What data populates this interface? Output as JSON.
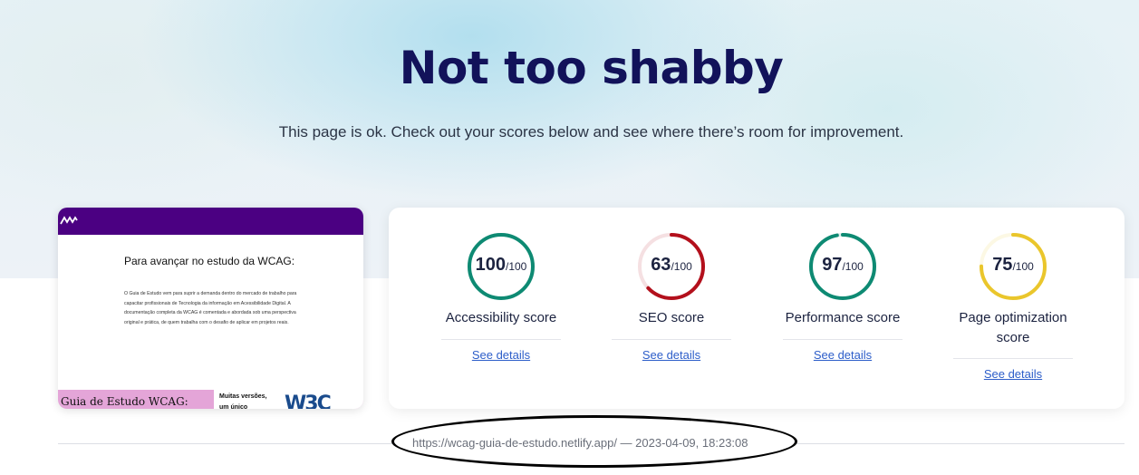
{
  "hero": {
    "title": "Not too shabby",
    "subtitle": "This page is ok. Check out your scores below and see where there’s room for improvement."
  },
  "thumbnail": {
    "heading": "Para avançar no estudo da WCAG:",
    "body": "O Guia de Estudo vem para suprir a demanda dentro do mercado de trabalho para capacitar profissionais de Tecnologia da informação em Acessibilidade Digital. A documentação completa da WCAG é comentada e abordada sob uma perspectiva original e prática, de quem trabalha com o desafio de aplicar em projetos reais.",
    "band_text": "Guia de Estudo WCAG:",
    "side_text": "Muitas versões, um único",
    "logo_text": "W3C",
    "colors": {
      "bar": "#4b0082",
      "band": "#e4a5d8"
    }
  },
  "scores": [
    {
      "value": 100,
      "max": "/100",
      "label": "Accessibility score",
      "link": "See details",
      "color": "#0e8a73"
    },
    {
      "value": 63,
      "max": "/100",
      "label": "SEO score",
      "link": "See details",
      "color": "#b3101c"
    },
    {
      "value": 97,
      "max": "/100",
      "label": "Performance score",
      "link": "See details",
      "color": "#0e8a73"
    },
    {
      "value": 75,
      "max": "/100",
      "label": "Page optimization score",
      "link": "See details",
      "color": "#eac62c"
    }
  ],
  "meta": "https://wcag-guia-de-estudo.netlify.app/ — 2023-04-09, 18:23:08"
}
